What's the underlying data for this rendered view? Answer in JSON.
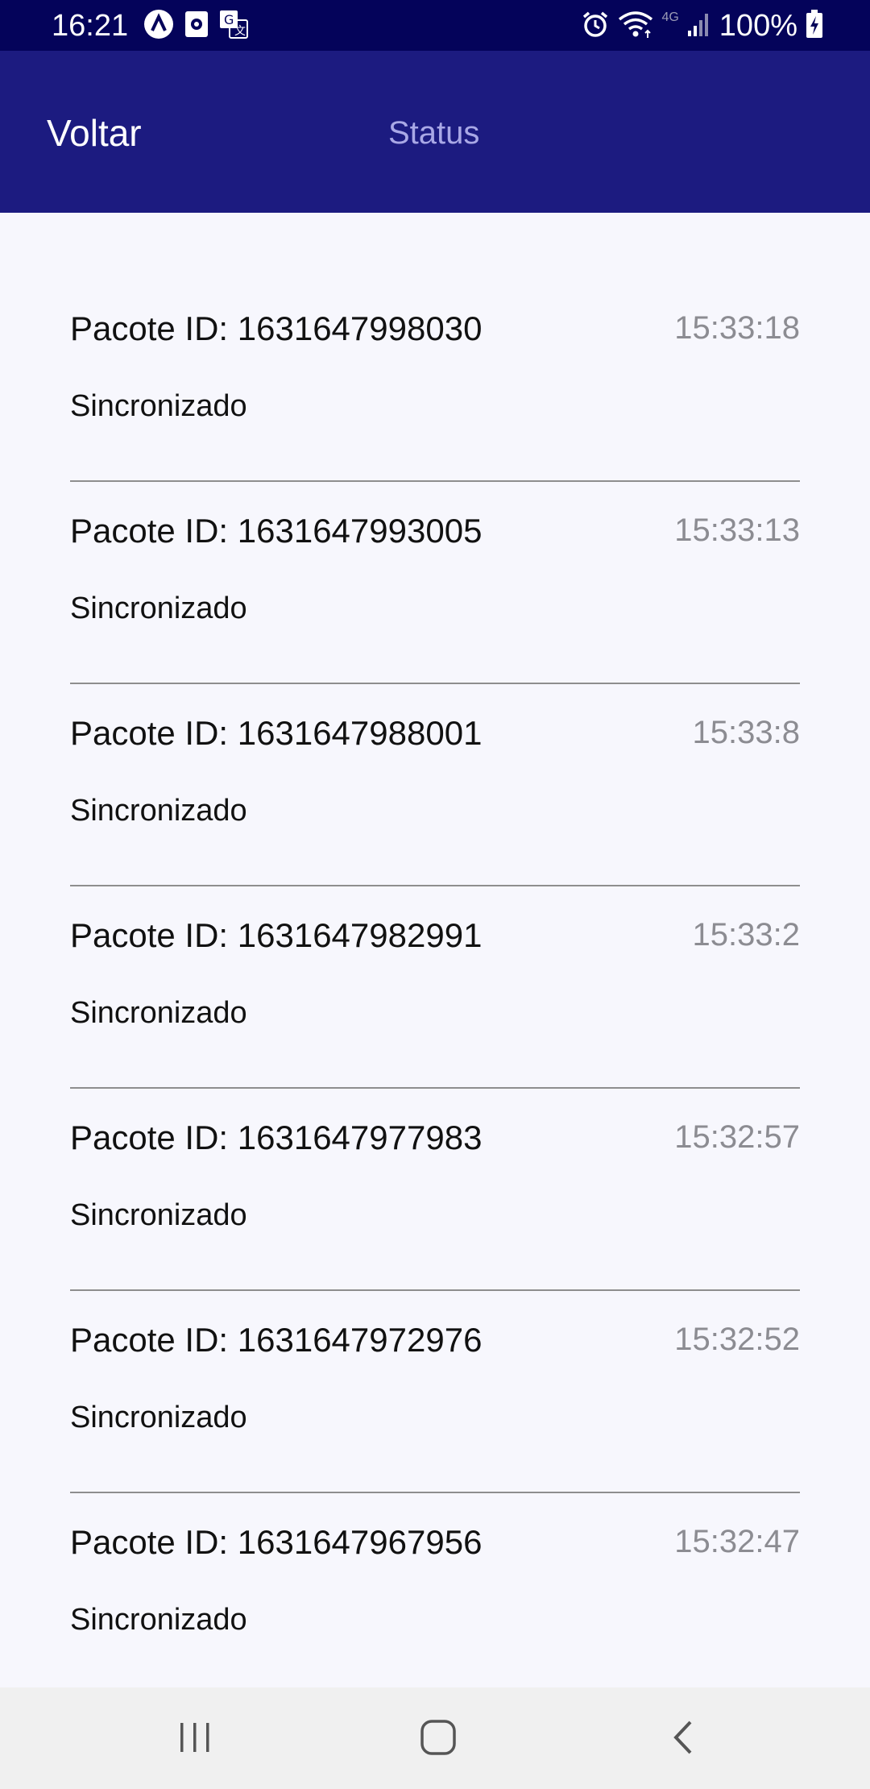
{
  "status_bar": {
    "time": "16:21",
    "battery": "100%",
    "network": "4G",
    "left_icons": [
      "assistant-icon",
      "screen-icon",
      "translate-icon"
    ],
    "right_icons": [
      "alarm-icon",
      "wifi-icon",
      "signal-icon",
      "battery-charging-icon"
    ]
  },
  "app_bar": {
    "back_label": "Voltar",
    "title": "Status"
  },
  "packets": [
    {
      "id_text": "Pacote ID: 1631647998030",
      "time": "15:33:18",
      "status": "Sincronizado"
    },
    {
      "id_text": "Pacote ID: 1631647993005",
      "time": "15:33:13",
      "status": "Sincronizado"
    },
    {
      "id_text": "Pacote ID: 1631647988001",
      "time": "15:33:8",
      "status": "Sincronizado"
    },
    {
      "id_text": "Pacote ID: 1631647982991",
      "time": "15:33:2",
      "status": "Sincronizado"
    },
    {
      "id_text": "Pacote ID: 1631647977983",
      "time": "15:32:57",
      "status": "Sincronizado"
    },
    {
      "id_text": "Pacote ID: 1631647972976",
      "time": "15:32:52",
      "status": "Sincronizado"
    },
    {
      "id_text": "Pacote ID: 1631647967956",
      "time": "15:32:47",
      "status": "Sincronizado"
    }
  ],
  "nav_bar": {
    "icons": [
      "recent-apps-icon",
      "home-icon",
      "back-icon"
    ]
  },
  "colors": {
    "status_bar": "#04035A",
    "app_bar": "#1C1B80",
    "title": "#A9A8E6",
    "background": "#F7F7FD",
    "time_text": "#8C8C92",
    "divider": "#8E8E8E"
  }
}
